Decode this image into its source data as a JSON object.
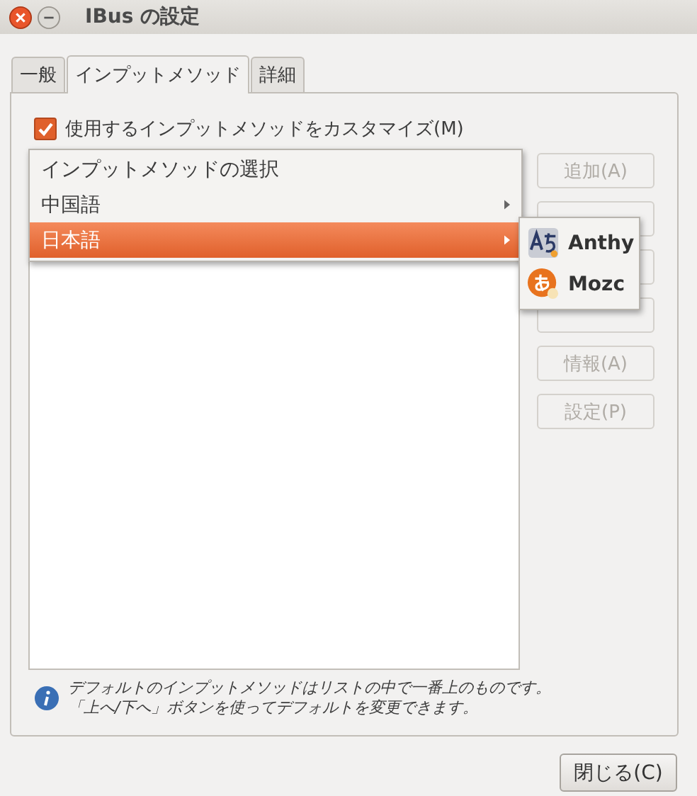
{
  "window": {
    "title": "IBus の設定"
  },
  "tabs": [
    {
      "label": "一般",
      "selected": false
    },
    {
      "label": "インプットメソッド",
      "selected": true
    },
    {
      "label": "詳細",
      "selected": false
    }
  ],
  "customize": {
    "label": "使用するインプットメソッドをカスタマイズ(M)",
    "checked": true
  },
  "side_buttons": [
    {
      "label": "追加(A)",
      "disabled": true
    },
    {
      "disabled": true
    },
    {
      "disabled": true
    },
    {
      "disabled": true
    },
    {
      "label": "情報(A)",
      "disabled": true
    },
    {
      "label": "設定(P)",
      "disabled": true
    }
  ],
  "menu": {
    "items": [
      {
        "label": "インプットメソッドの選択",
        "submenu": false,
        "selected": false
      },
      {
        "label": "中国語",
        "submenu": true,
        "selected": false
      },
      {
        "label": "日本語",
        "submenu": true,
        "selected": true
      }
    ],
    "submenu": [
      {
        "label": "Anthy",
        "kind": "anthy"
      },
      {
        "label": "Mozc",
        "kind": "mozc"
      }
    ]
  },
  "info": [
    "デフォルトのインプットメソッドはリストの中で一番上のものです。",
    "「上へ/下へ」ボタンを使ってデフォルトを変更できます。"
  ],
  "close_button": {
    "label": "閉じる(C)"
  }
}
